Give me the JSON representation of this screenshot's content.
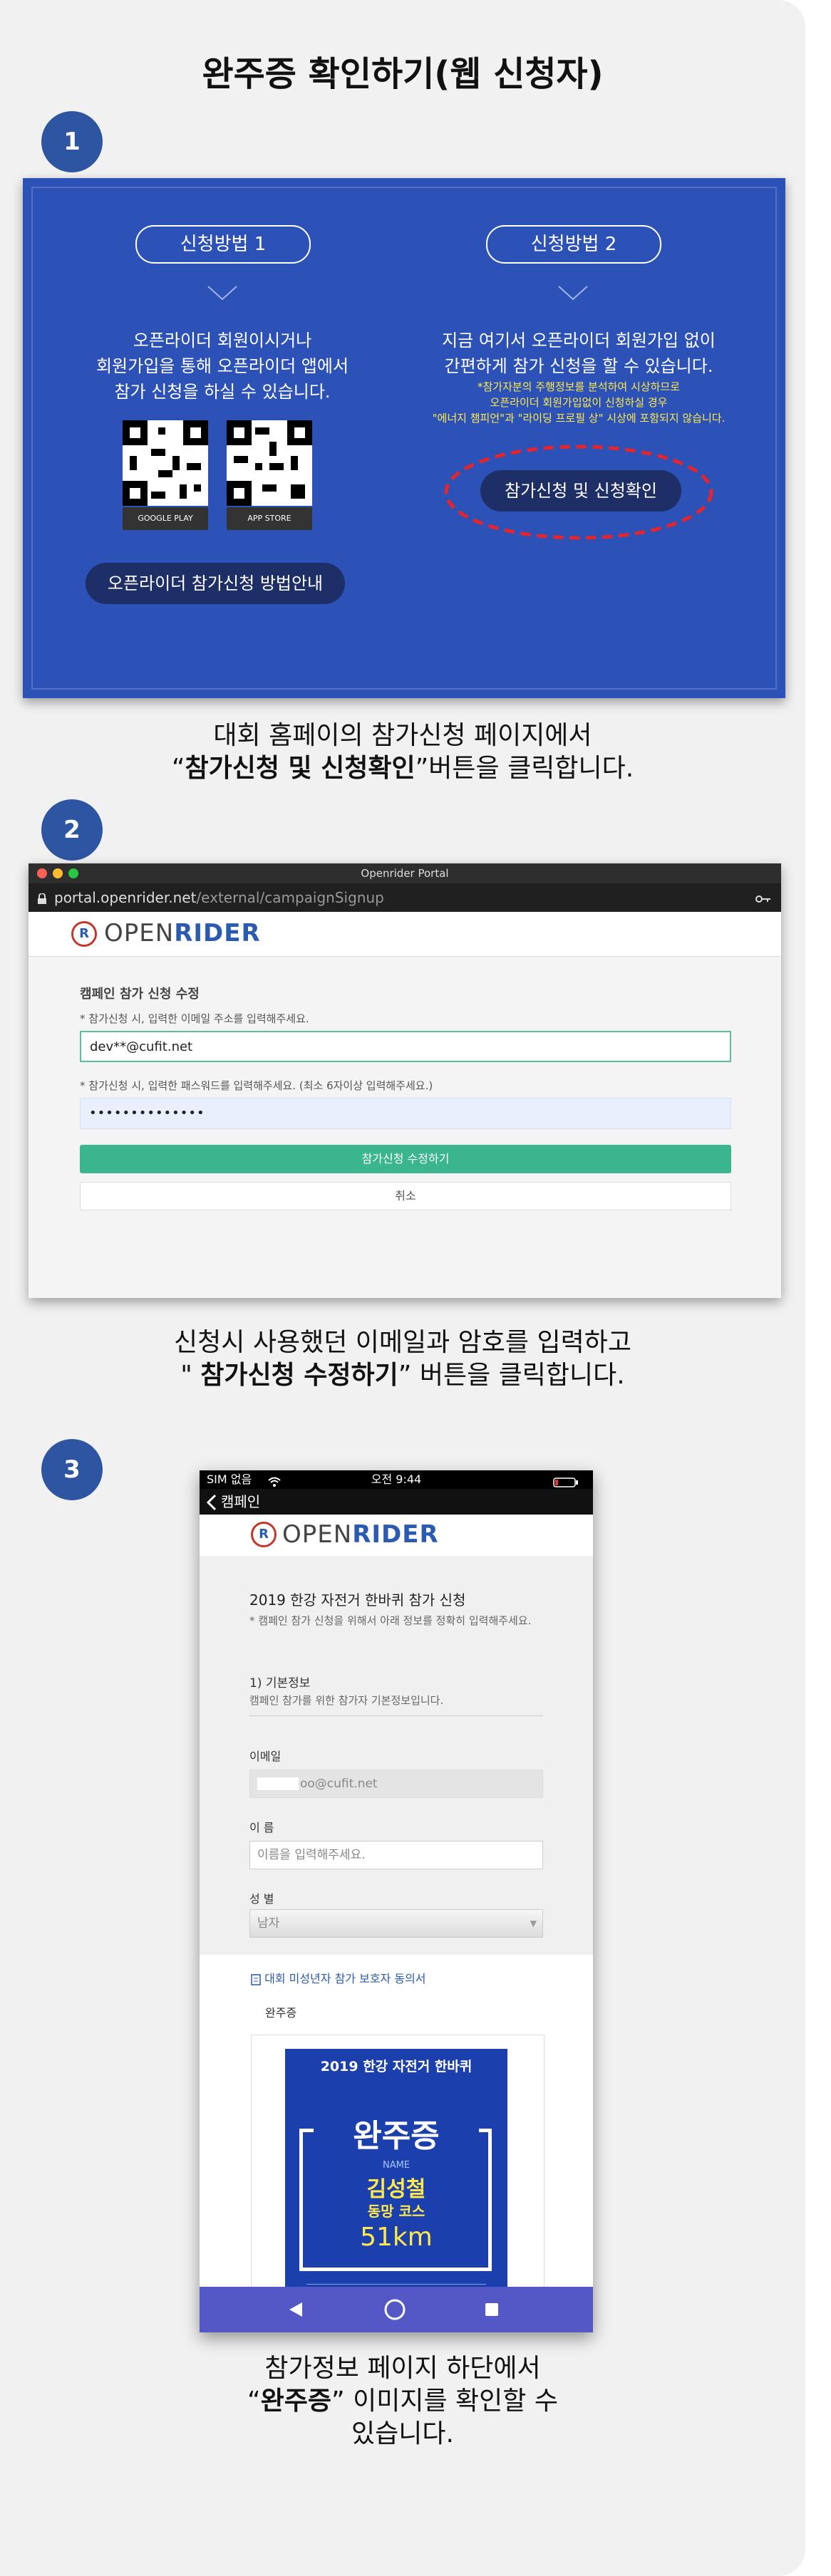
{
  "page_title": "완주증 확인하기(웹 신청자)",
  "steps": [
    "1",
    "2",
    "3"
  ],
  "colors": {
    "accent_blue": "#2d55a1",
    "panel_bg": "#f1f1f1",
    "highlight_red": "#e5242b",
    "submit_green": "#3ab58d"
  },
  "step1": {
    "method1_label": "신청방법 1",
    "method1_text": [
      "오픈라이더 회원이시거나",
      "회원가입을 통해 오픈라이더 앱에서",
      "참가 신청을 하실 수 있습니다."
    ],
    "google_play": "GOOGLE PLAY",
    "app_store": "APP STORE",
    "guide_button": "오픈라이더 참가신청 방법안내",
    "method2_label": "신청방법 2",
    "method2_text": [
      "지금 여기서 오픈라이더 회원가입 없이",
      "간편하게 참가 신청을 할 수 있습니다."
    ],
    "method2_notes": [
      "*참가자분의 주행정보를 분석하여 시상하므로",
      "오픈라이더 회원가입없이 신청하실 경우",
      "\"에너지 챔피언\"과 \"라이딩 프로필 상\" 시상에 포함되지 않습니다."
    ],
    "apply_button": "참가신청 및 신청확인"
  },
  "caption1": {
    "line1": "대회 홈페이의 참가신청 페이지에서",
    "open_quote": "“",
    "bold": "참가신청 및 신청확인",
    "rest": "”버튼을 클릭합니다."
  },
  "step2": {
    "window_title": "Openrider Portal",
    "url_host": "portal.openrider.net",
    "url_path": "/external/campaignSignup",
    "brand_open": "OPEN",
    "brand_rider": "RIDER",
    "logo_letter": "R",
    "form_title": "캠페인 참가 신청 수정",
    "email_hint": "* 참가신청 시, 입력한 이메일 주소를 입력해주세요.",
    "email_value": "dev**@cufit.net",
    "password_hint": "* 참가신청 시, 입력한 패스워드를 입력해주세요. (최소 6자이상 입력해주세요.)",
    "password_value": "••••••••••••••",
    "submit_button": "참가신청 수정하기",
    "cancel_button": "취소"
  },
  "caption2": {
    "line1": "신청시 사용했던 이메일과 암호를 입력하고",
    "open_quote": "\" ",
    "bold": "참가신청 수정하기",
    "rest": "” 버튼을 클릭합니다."
  },
  "step3": {
    "status_left": "SIM 없음",
    "status_time": "오전 9:44",
    "back_label": "캠페인",
    "page_heading": "2019 한강 자전거 한바퀴 참가 신청",
    "page_desc": "* 캠페인 참가 신청을 위해서 아래 정보를 정확히 입력해주세요.",
    "section_title": "1) 기본정보",
    "section_desc": "캠페인 참가를 위한 참가자 기본정보입니다.",
    "email_label": "이메일",
    "email_value": "oo@cufit.net",
    "name_label": "이 름",
    "name_placeholder": "이름을 입력해주세요.",
    "gender_label": "성 별",
    "gender_value": "남자",
    "consent_link": "대회 미성년자 참가 보호자 동의서",
    "cert_label": "완주증",
    "cert_event": "2019 한강 자전거 한바퀴",
    "cert_title": "완주증",
    "cert_name_label": "NAME",
    "cert_name": "김성철",
    "cert_course": "동망 코스",
    "cert_distance": "51km"
  },
  "caption3": {
    "line1": "참가정보 페이지 하단에서",
    "open_quote": "“",
    "bold": "완주증",
    "rest": "” 이미지를 확인할 수",
    "line3": "있습니다."
  }
}
